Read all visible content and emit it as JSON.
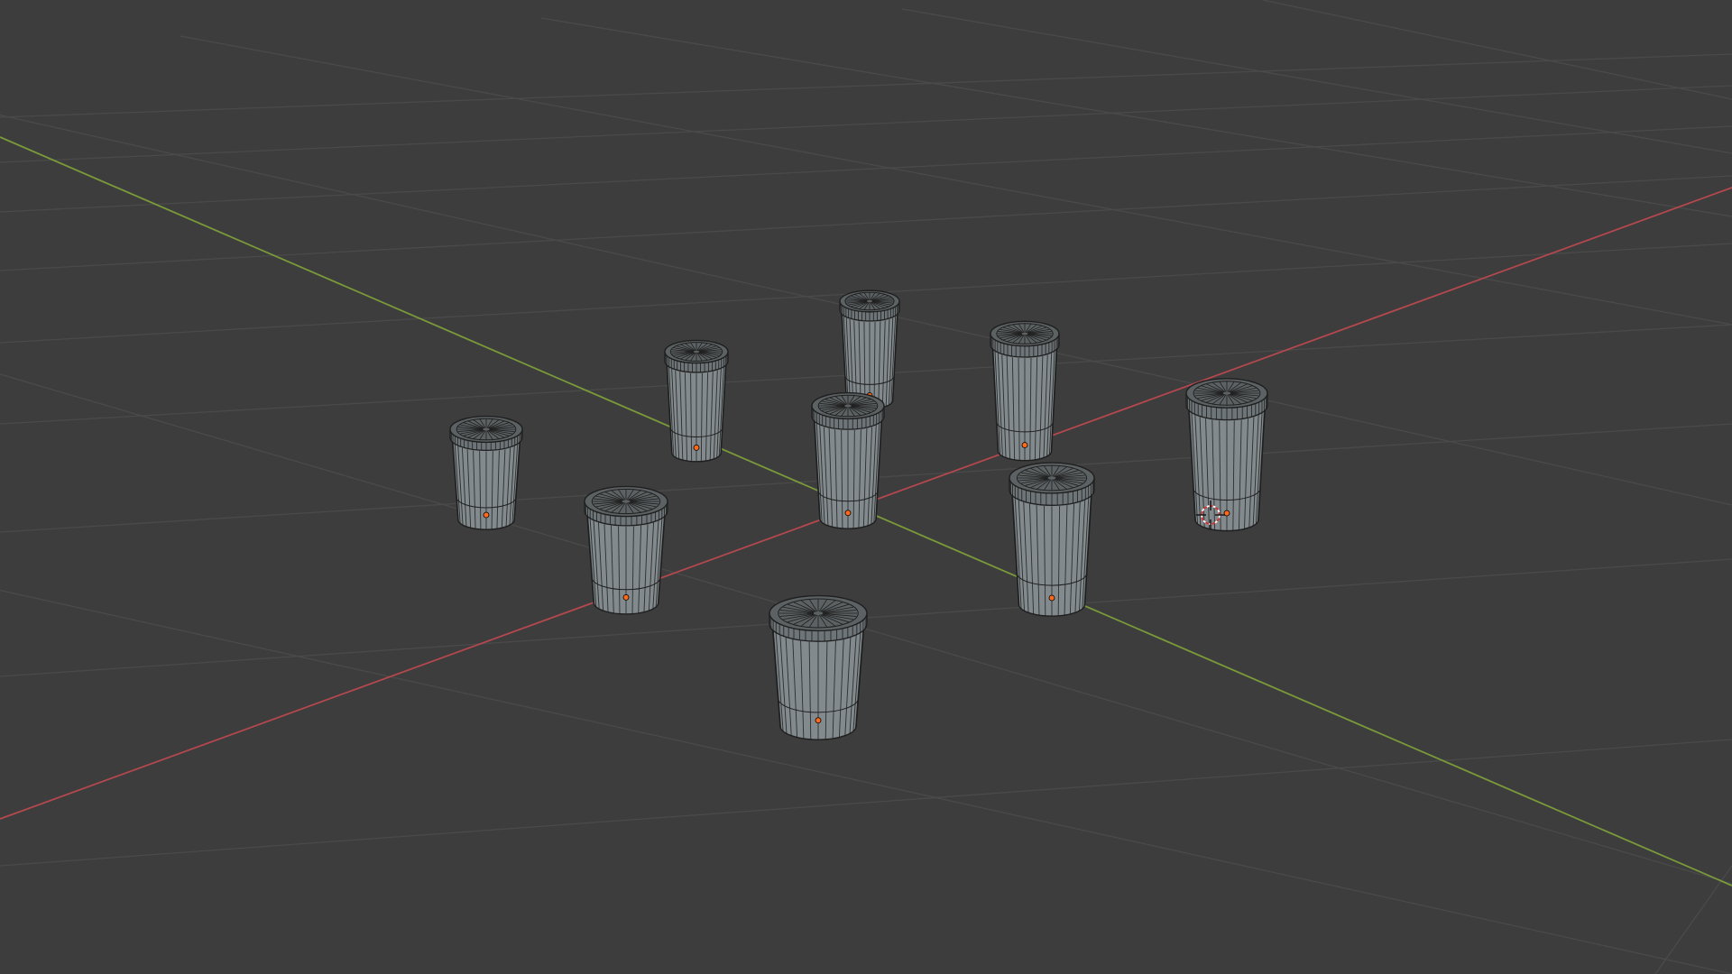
{
  "viewport": {
    "background_color": "#3d3d3d",
    "grid_color": "#4a4a4a",
    "x_axis_color": "#b3484e",
    "y_axis_color": "#7a9a3a",
    "object_fill_color": "#828a8d",
    "wire_color": "#1f1f1f",
    "origin_color": "#ff6a1a",
    "cursor_icon": "3d-cursor-icon",
    "object_type": "takeaway-cup-mesh",
    "object_count": 9,
    "display_mode": "wireframe-overlay"
  }
}
